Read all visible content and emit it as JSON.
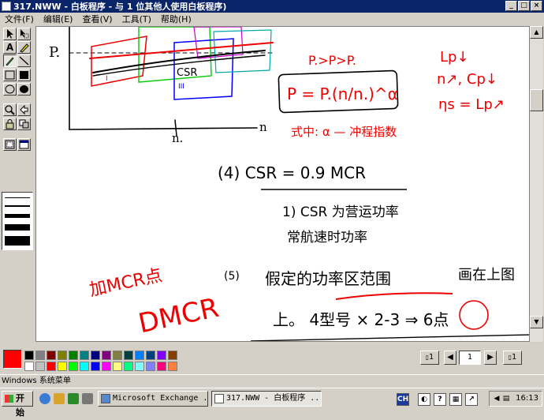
{
  "window": {
    "title": "317.NWW - 白板程序 - 与 1 位其他人使用白板程序)",
    "btn_min": "_",
    "btn_max": "□",
    "btn_close": "×"
  },
  "menu": [
    "文件(F)",
    "编辑(E)",
    "查看(V)",
    "工具(T)",
    "帮助(H)"
  ],
  "toolbox": {
    "tools": [
      "select-arrow",
      "zoom-select",
      "text",
      "highlighter",
      "pen",
      "line",
      "unfilled-rect",
      "filled-rect",
      "unfilled-ellipse",
      "filled-ellipse",
      "zoom",
      "remote-pointer",
      "lock",
      "sync",
      "select-area",
      "select-window"
    ],
    "text_tool_glyph": "A"
  },
  "whiteboard": {
    "note": "",
    "handwriting": {
      "p0_label": "P.",
      "n0_label": "n.",
      "n_axis": "n",
      "csr_label": "CSR",
      "ineq": "P.>P>P.",
      "formula": "P = P.(n/n.)^α",
      "formula_note": "式中: α — 冲程指数",
      "item4": "(4)  CSR = 0.9 MCR",
      "csr_note1": "1) CSR 为营运功率",
      "csr_note2": "常航速时功率",
      "right1": "Lp↓",
      "right2": "n↗, Cp↓",
      "right3": "ηs = Lp↗",
      "left_red1": "加MCR点",
      "left_red2": "DMCR",
      "item5": "(5)",
      "line5a": "假定的功率区范围",
      "line5b": "画在上图",
      "line5c": "上。  4型号 × 2-3 ⇒ 6点"
    }
  },
  "colors": {
    "current": "#ff0000",
    "swatches": [
      "#000000",
      "#808080",
      "#800000",
      "#808000",
      "#008000",
      "#008080",
      "#000080",
      "#800080",
      "#808040",
      "#004040",
      "#0080ff",
      "#004080",
      "#8000ff",
      "#804000",
      "#ffffff",
      "#c0c0c0",
      "#ff0000",
      "#ffff00",
      "#00ff00",
      "#00ffff",
      "#0000ff",
      "#ff00ff",
      "#ffff80",
      "#00ff80",
      "#80ffff",
      "#8080ff",
      "#ff0080",
      "#ff8040"
    ]
  },
  "pager": {
    "first_label": "1",
    "prev_label": "◀",
    "current": "1",
    "next_label": "▶",
    "last_label": "1"
  },
  "status": "Windows 系统菜单",
  "taskbar": {
    "start_label": "开始",
    "tasks": [
      "Microsoft Exchange ...",
      "317.NWW - 白板程序 ..."
    ],
    "tray_lang": "CH",
    "clock": "16:13"
  }
}
